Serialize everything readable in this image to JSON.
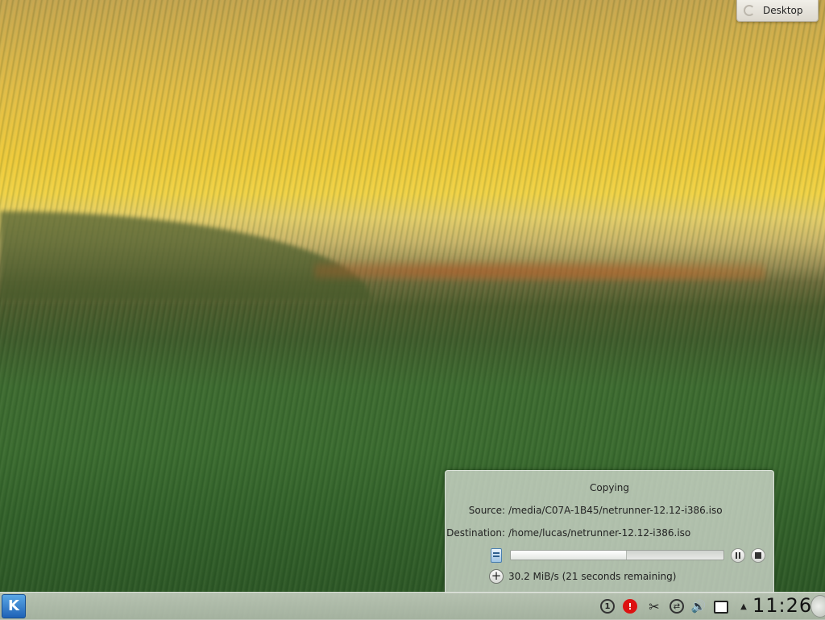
{
  "desktop_toolbox": {
    "label": "Desktop"
  },
  "job": {
    "title": "Copying",
    "source_label": "Source:",
    "source_value": "/media/C07A-1B45/netrunner-12.12-i386.iso",
    "destination_label": "Destination:",
    "destination_value": "/home/lucas/netrunner-12.12-i386.iso",
    "progress": 0.54,
    "speed_text": "30.2 MiB/s (21 seconds remaining)"
  },
  "panel": {
    "launcher_glyph": "K",
    "tray": {
      "updates_glyph": "1",
      "notifications_glyph": "!",
      "klipper_glyph": "✂",
      "network_glyph": "⇄",
      "volume_glyph": "🔊",
      "expand_glyph": "▲"
    },
    "clock": "11:26"
  }
}
